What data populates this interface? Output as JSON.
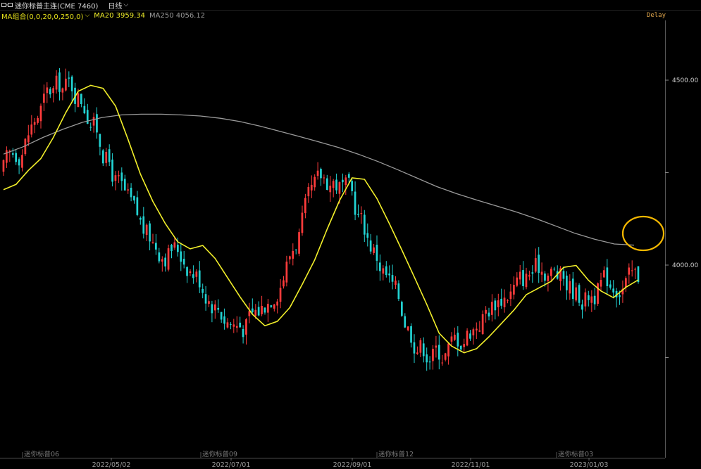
{
  "header": {
    "instrument": "迷你标普主连(CME 7460)",
    "period": "日线",
    "period_chevron": "chevron-down-icon"
  },
  "indicators": {
    "ma_group": "MA组合(0,0,20,0,250,0)",
    "ma20_label": "MA20 3959.34",
    "ma250_label": "MA250 4056.12",
    "chevron": "chevron-down-icon"
  },
  "status": {
    "delay": "Delay"
  },
  "price_axis": {
    "labels": [
      {
        "text": "4500.00",
        "value": 4500
      },
      {
        "text": "4000.00",
        "value": 4000
      }
    ],
    "ticks": [
      4500,
      4250,
      4000,
      3750
    ]
  },
  "date_axis": [
    {
      "text": "2022/05/02"
    },
    {
      "text": "2022/07/01"
    },
    {
      "text": "2022/09/01"
    },
    {
      "text": "2022/11/01"
    },
    {
      "text": "2023/01/03"
    }
  ],
  "contract_labels": [
    {
      "text": "迷你标普06"
    },
    {
      "text": "迷你标普09"
    },
    {
      "text": "迷你标普12"
    },
    {
      "text": "迷你标普03"
    }
  ],
  "colors": {
    "up": "#ff3b3b",
    "down": "#22d3d3",
    "ma20": "#f2ef2a",
    "ma250": "#9a9a9a",
    "highlight": "#f5b800",
    "background": "#000000"
  },
  "chart_data": {
    "type": "candlestick",
    "ylim": [
      3550,
      4730
    ],
    "series": [
      {
        "name": "MA20",
        "values": [
          4204,
          4218,
          4256,
          4288,
          4345,
          4412,
          4470,
          4486,
          4478,
          4430,
          4340,
          4246,
          4172,
          4112,
          4063,
          4044,
          4053,
          4018,
          3966,
          3914,
          3867,
          3836,
          3848,
          3885,
          3948,
          4014,
          4097,
          4175,
          4236,
          4232,
          4180,
          4112,
          4041,
          3968,
          3894,
          3816,
          3781,
          3763,
          3774,
          3806,
          3842,
          3878,
          3920,
          3938,
          3956,
          3994,
          3999,
          3959,
          3930,
          3912,
          3940,
          3960
        ]
      },
      {
        "name": "MA250",
        "values": [
          4300,
          4320,
          4345,
          4367,
          4386,
          4399,
          4406,
          4408,
          4408,
          4406,
          4403,
          4397,
          4388,
          4376,
          4362,
          4348,
          4333,
          4318,
          4300,
          4280,
          4258,
          4235,
          4212,
          4193,
          4176,
          4160,
          4144,
          4126,
          4106,
          4086,
          4070,
          4057,
          4054
        ]
      }
    ]
  }
}
